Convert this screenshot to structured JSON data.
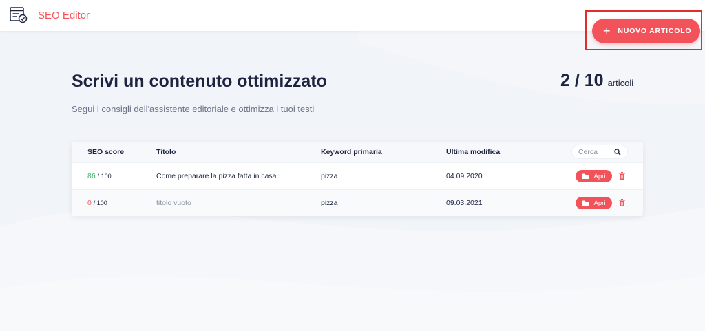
{
  "app": {
    "title": "SEO Editor",
    "new_article_label": "NUOVO ARTICOLO",
    "accent": "#f2535b"
  },
  "main": {
    "heading": "Scrivi un contenuto ottimizzato",
    "subtitle": "Segui i consigli dell'assistente editoriale e ottimizza i tuoi testi",
    "counter": "2 / 10",
    "counter_suffix": "articoli"
  },
  "table": {
    "columns": {
      "score": "SEO score",
      "title": "Titolo",
      "keyword": "Keyword primaria",
      "modified": "Ultima modifica"
    },
    "search_placeholder": "Cerca",
    "rows": [
      {
        "score": "86",
        "score_max": "/ 100",
        "title": "Come preparare la pizza fatta in casa",
        "keyword": "pizza",
        "modified": "04.09.2020",
        "open_label": "Apri"
      },
      {
        "score": "0",
        "score_max": "/ 100",
        "title": "titolo vuoto",
        "keyword": "pizza",
        "modified": "09.03.2021",
        "open_label": "Apri"
      }
    ]
  },
  "icons": {
    "logo": "document-check-icon",
    "add": "plus-icon",
    "search": "search-icon",
    "open": "folder-icon",
    "delete": "trash-icon"
  },
  "colors": {
    "score_good": "#3bb26c",
    "score_bad": "#f2535b",
    "highlight": "#e32c2c"
  }
}
